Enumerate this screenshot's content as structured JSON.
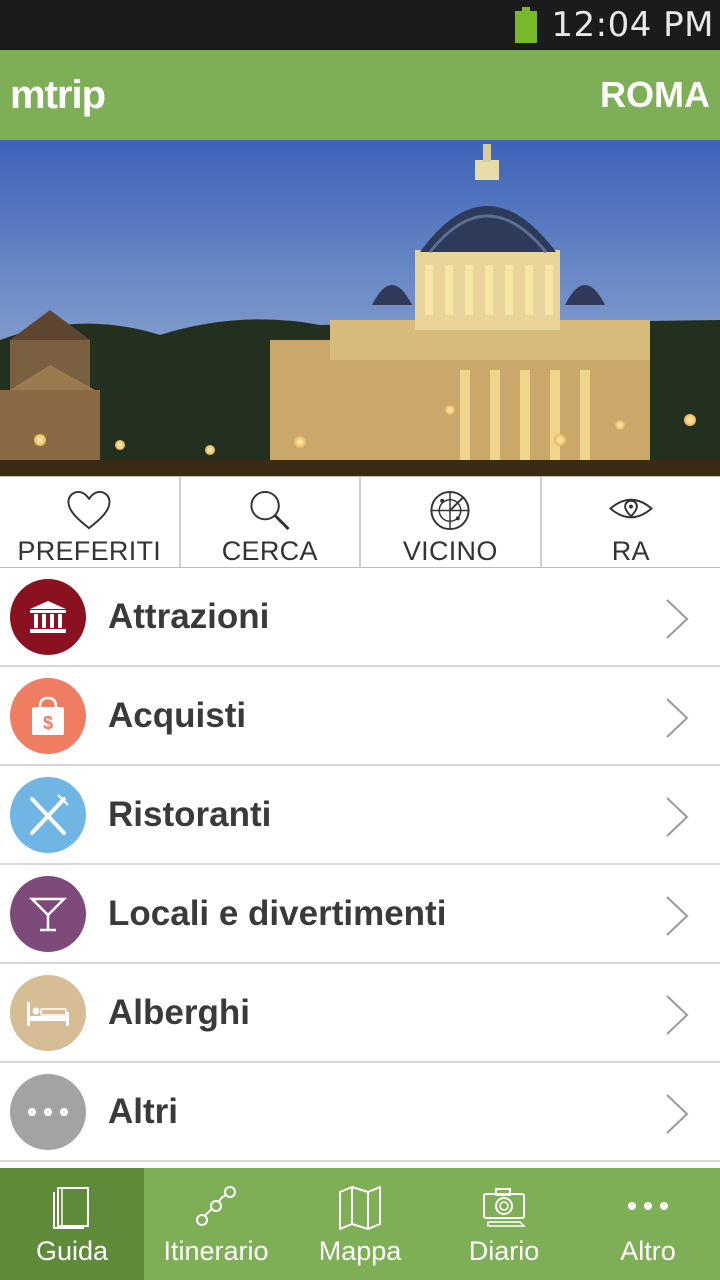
{
  "status_bar": {
    "time": "12:04 PM",
    "battery_color": "#79b82a"
  },
  "header": {
    "logo": "mtrip",
    "city": "ROMA",
    "bg_color": "#7eae55"
  },
  "hero": {
    "image_subject": "st-peters-basilica-at-dusk"
  },
  "quick_actions": [
    {
      "label": "PREFERITI",
      "icon": "heart-icon"
    },
    {
      "label": "CERCA",
      "icon": "search-icon"
    },
    {
      "label": "VICINO",
      "icon": "radar-icon"
    },
    {
      "label": "RA",
      "icon": "eye-icon"
    }
  ],
  "categories": [
    {
      "label": "Attrazioni",
      "icon": "museum-icon",
      "color": "#8a1220"
    },
    {
      "label": "Acquisti",
      "icon": "shopping-bag-icon",
      "color": "#ef7d62"
    },
    {
      "label": "Ristoranti",
      "icon": "cutlery-icon",
      "color": "#6fb6e4"
    },
    {
      "label": "Locali e divertimenti",
      "icon": "cocktail-icon",
      "color": "#7d4a7a"
    },
    {
      "label": "Alberghi",
      "icon": "bed-icon",
      "color": "#d6bd96"
    },
    {
      "label": "Altri",
      "icon": "more-icon",
      "color": "#a3a3a3"
    }
  ],
  "bottom_nav": [
    {
      "label": "Guida",
      "icon": "guide-book-icon",
      "active": true
    },
    {
      "label": "Itinerario",
      "icon": "route-icon",
      "active": false
    },
    {
      "label": "Mappa",
      "icon": "map-icon",
      "active": false
    },
    {
      "label": "Diario",
      "icon": "camera-icon",
      "active": false
    },
    {
      "label": "Altro",
      "icon": "more-icon",
      "active": false
    }
  ]
}
